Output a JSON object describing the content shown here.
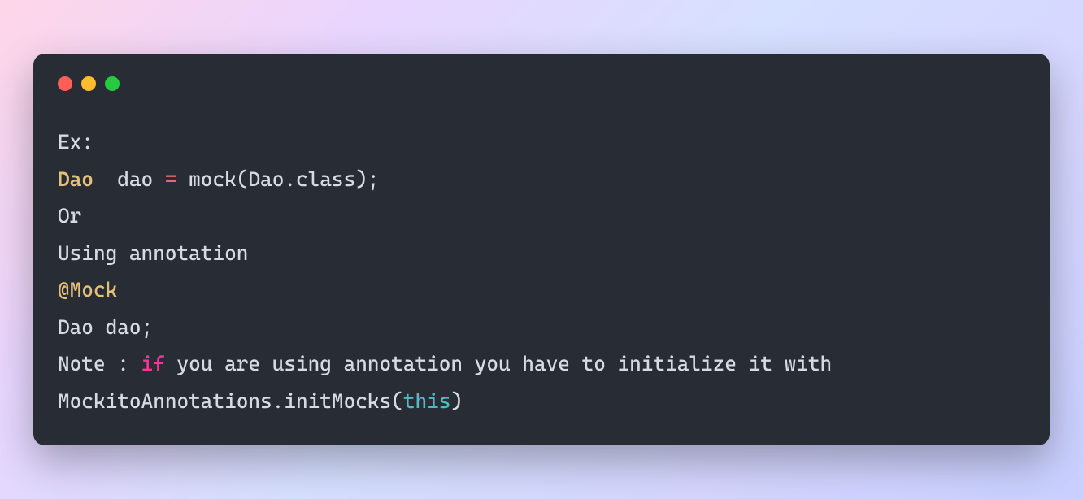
{
  "code": {
    "lines": [
      {
        "tokens": [
          {
            "text": "Ex:",
            "cls": "tok-normal"
          }
        ]
      },
      {
        "tokens": [
          {
            "text": "Dao",
            "cls": "tok-type"
          },
          {
            "text": "  dao ",
            "cls": "tok-normal"
          },
          {
            "text": "=",
            "cls": "tok-keyword"
          },
          {
            "text": " mock(Dao.class);",
            "cls": "tok-normal"
          }
        ]
      },
      {
        "tokens": [
          {
            "text": "Or",
            "cls": "tok-normal"
          }
        ]
      },
      {
        "tokens": [
          {
            "text": "Using annotation",
            "cls": "tok-normal"
          }
        ]
      },
      {
        "tokens": [
          {
            "text": "@Mock",
            "cls": "tok-annotation"
          }
        ]
      },
      {
        "tokens": [
          {
            "text": "Dao dao;",
            "cls": "tok-normal"
          }
        ]
      },
      {
        "tokens": [
          {
            "text": "Note : ",
            "cls": "tok-normal"
          },
          {
            "text": "if",
            "cls": "tok-keyword-pink"
          },
          {
            "text": " you are using annotation you have to initialize it with",
            "cls": "tok-normal"
          }
        ]
      },
      {
        "tokens": [
          {
            "text": "MockitoAnnotations.initMocks(",
            "cls": "tok-normal"
          },
          {
            "text": "this",
            "cls": "tok-this"
          },
          {
            "text": ")",
            "cls": "tok-normal"
          }
        ]
      }
    ]
  }
}
